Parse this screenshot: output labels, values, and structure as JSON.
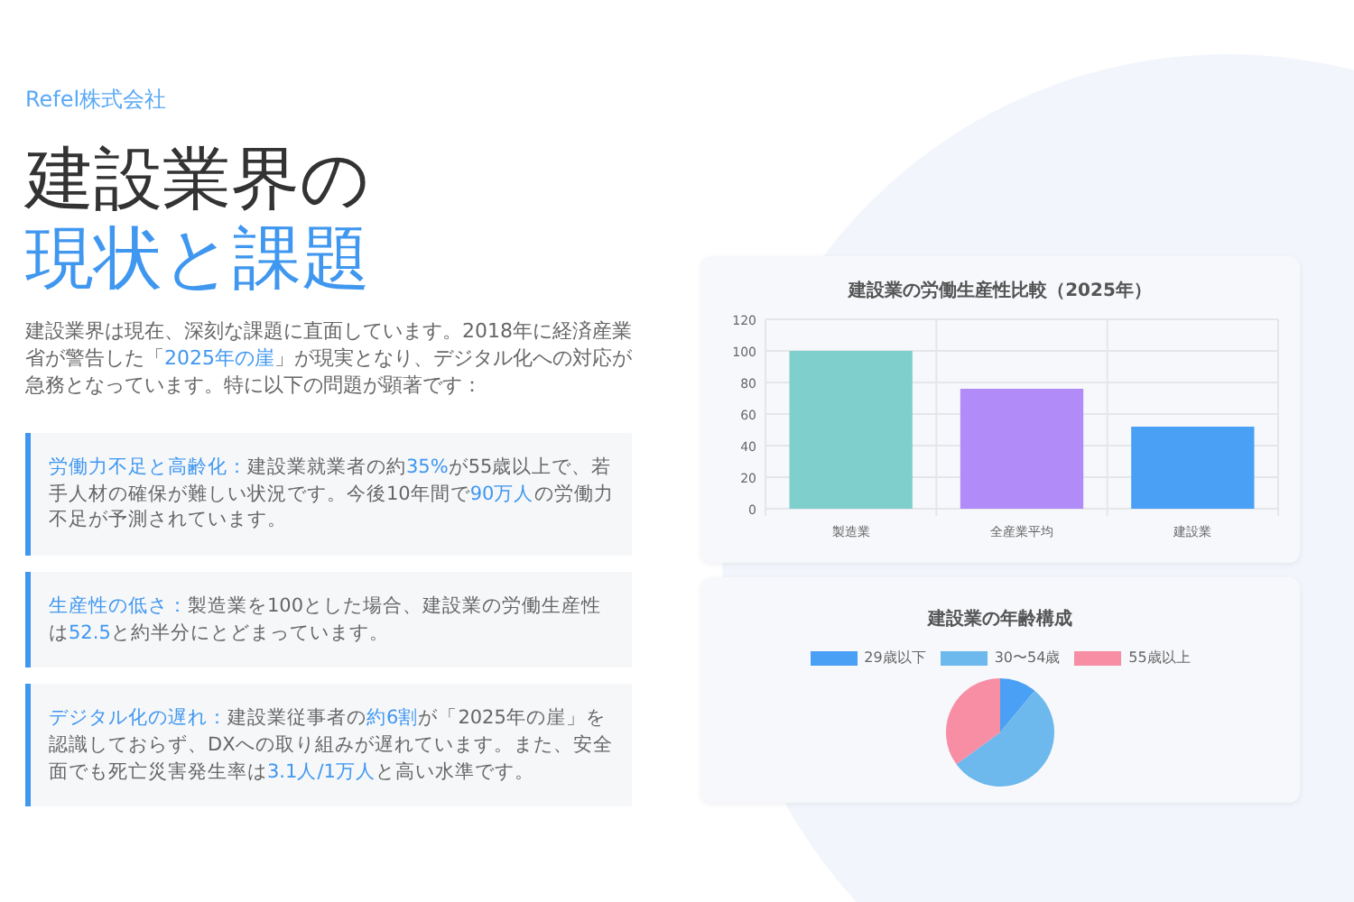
{
  "company": "Refel株式会社",
  "title": {
    "line_1": "建設業界の",
    "line_2": "現状と課題"
  },
  "intro": [
    {
      "text": "建設業界は現在、深刻な課題に直面しています。2018年に経済産業省が警告した「",
      "highlight": false
    },
    {
      "text": "2025年の崖",
      "highlight": true
    },
    {
      "text": "」が現実となり、デジタル化への対応が急務となっています。特に以下の問題が顕著です：",
      "highlight": false
    }
  ],
  "issues": [
    {
      "segments": [
        {
          "text": "労働力不足と高齢化：",
          "highlight": true
        },
        {
          "text": "建設業就業者の約",
          "highlight": false
        },
        {
          "text": "35%",
          "highlight": true
        },
        {
          "text": "が55歳以上で、若手人材の確保が難しい状況です。今後10年間で",
          "highlight": false
        },
        {
          "text": "90万人",
          "highlight": true
        },
        {
          "text": "の労働力不足が予測されています。",
          "highlight": false
        }
      ]
    },
    {
      "segments": [
        {
          "text": "生産性の低さ：",
          "highlight": true
        },
        {
          "text": "製造業を100とした場合、建設業の労働生産性は",
          "highlight": false
        },
        {
          "text": "52.5",
          "highlight": true
        },
        {
          "text": "と約半分にとどまっています。",
          "highlight": false
        }
      ]
    },
    {
      "segments": [
        {
          "text": "デジタル化の遅れ：",
          "highlight": true
        },
        {
          "text": "建設業従事者の",
          "highlight": false
        },
        {
          "text": "約6割",
          "highlight": true
        },
        {
          "text": "が「2025年の崖」を認識しておらず、DXへの取り組みが遅れています。また、安全面でも死亡災害発生率は",
          "highlight": false
        },
        {
          "text": "3.1人/1万人",
          "highlight": true
        },
        {
          "text": "と高い水準です。",
          "highlight": false
        }
      ]
    }
  ],
  "productivity_chart": {
    "chart_data": {
      "type": "bar",
      "title": "建設業の労働生産性比較（2025年）",
      "categories": [
        "製造業",
        "全産業平均",
        "建設業"
      ],
      "series": [
        {
          "color": "#7fcfcc",
          "values": [
            100,
            null,
            null
          ]
        },
        {
          "color": "#b18cf8",
          "values": [
            null,
            76,
            null
          ]
        },
        {
          "color": "#4aa0f5",
          "values": [
            null,
            null,
            52
          ]
        }
      ],
      "ylim": [
        0,
        120
      ],
      "yticks": [
        0,
        20,
        40,
        60,
        80,
        100,
        120
      ],
      "grid": true
    }
  },
  "age_chart": {
    "title": "建設業の年齢構成",
    "legend": [
      {
        "label": "29歳以下",
        "color": "#4aa0f5"
      },
      {
        "label": "30〜54歳",
        "color": "#6db8ec"
      },
      {
        "label": "55歳以上",
        "color": "#f78ea4"
      }
    ]
  }
}
